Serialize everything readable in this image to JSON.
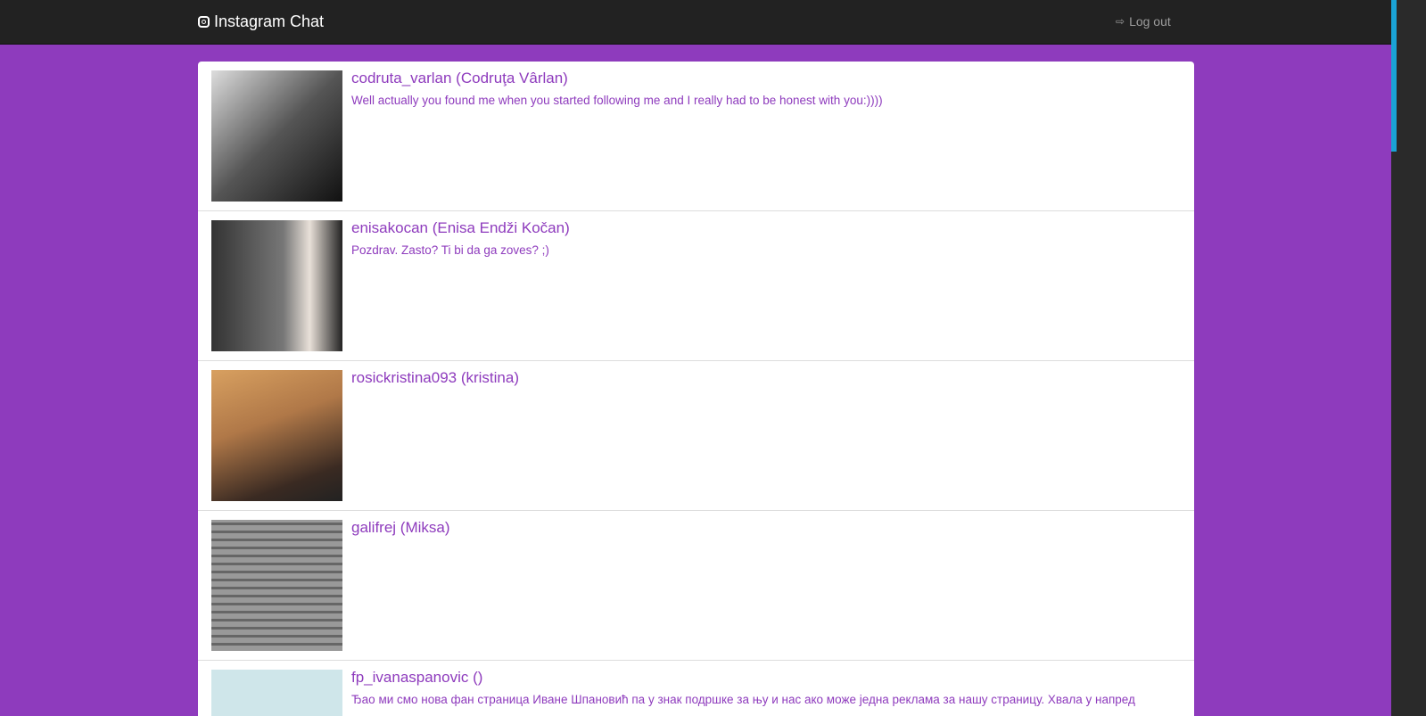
{
  "navbar": {
    "brand": "Instagram Chat",
    "logout_label": "Log out"
  },
  "conversations": [
    {
      "username": "codruta_varlan (Codruţa Vârlan)",
      "message": "Well actually you found me when you started following me and I really had to be honest with you:))))",
      "avatar_color": "#6a6a6a"
    },
    {
      "username": "enisakocan (Enisa Endži Kočan)",
      "message": "Pozdrav. Zasto? Ti bi da ga zoves? ;)",
      "avatar_color": "#7a7470"
    },
    {
      "username": "rosickristina093 (kristina)",
      "message": "",
      "avatar_color": "#b08050"
    },
    {
      "username": "galifrej (Miksa)",
      "message": "",
      "avatar_color": "#8a8a8a"
    },
    {
      "username": "fp_ivanaspanovic ()",
      "message": "Ђао ми смо нова фан страница Иване Шпановић па у знак подршке за њу и нас ако може једна реклама за нашу страницу. Хвала у напред",
      "avatar_color": "#cfe6ea"
    }
  ]
}
